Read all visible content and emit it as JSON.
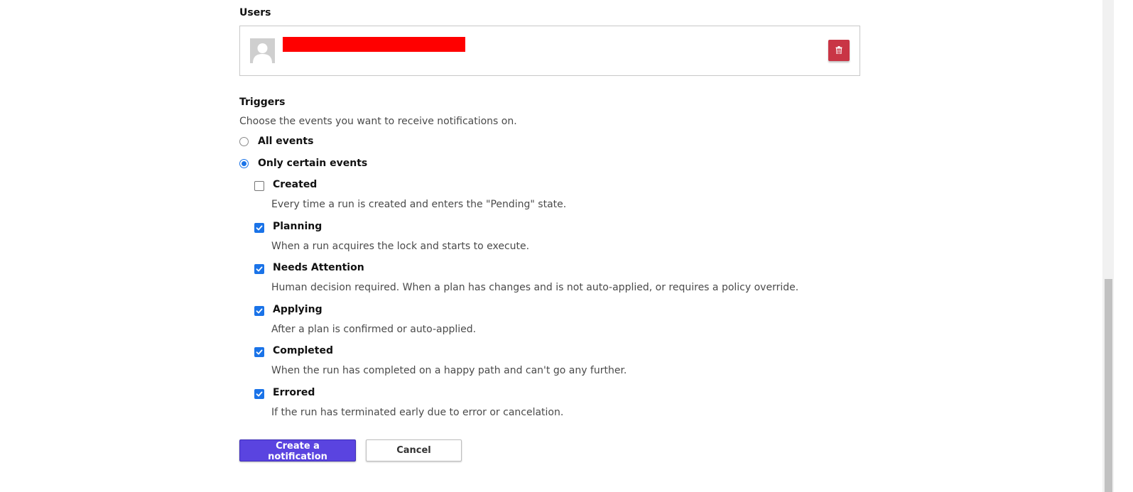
{
  "users": {
    "heading": "Users",
    "delete_label": "Delete user"
  },
  "triggers": {
    "heading": "Triggers",
    "description": "Choose the events you want to receive notifications on.",
    "mode_options": [
      {
        "label": "All events",
        "selected": false
      },
      {
        "label": "Only certain events",
        "selected": true
      }
    ],
    "events": [
      {
        "label": "Created",
        "description": "Every time a run is created and enters the \"Pending\" state.",
        "checked": false
      },
      {
        "label": "Planning",
        "description": "When a run acquires the lock and starts to execute.",
        "checked": true
      },
      {
        "label": "Needs Attention",
        "description": "Human decision required. When a plan has changes and is not auto-applied, or requires a policy override.",
        "checked": true
      },
      {
        "label": "Applying",
        "description": "After a plan is confirmed or auto-applied.",
        "checked": true
      },
      {
        "label": "Completed",
        "description": "When the run has completed on a happy path and can't go any further.",
        "checked": true
      },
      {
        "label": "Errored",
        "description": "If the run has terminated early due to error or cancelation.",
        "checked": true
      }
    ]
  },
  "actions": {
    "create_label": "Create a notification",
    "cancel_label": "Cancel"
  },
  "colors": {
    "primary": "#5a44e0",
    "danger": "#c93545",
    "check_accent": "#1a73e8",
    "redaction": "#ff0000"
  }
}
